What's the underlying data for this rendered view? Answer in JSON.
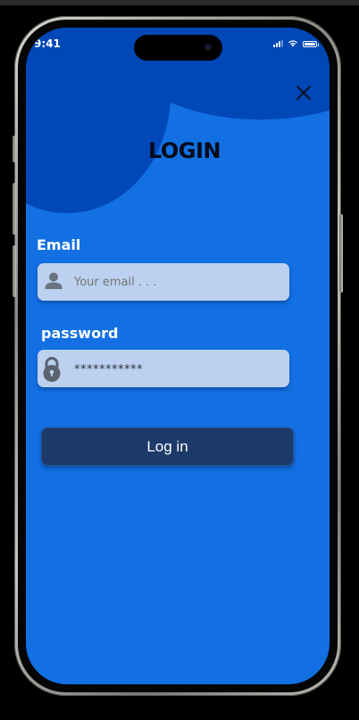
{
  "status_bar": {
    "time": "9:41"
  },
  "title": "LOGIN",
  "email": {
    "label": "Email",
    "placeholder": "Your email . . ."
  },
  "password": {
    "label": "password",
    "masked_value": "***********"
  },
  "login_button": {
    "label": "Log in"
  },
  "colors": {
    "screen_background": "#1270e3",
    "decor_blob": "#0047b8",
    "input_background": "#bcd1ef",
    "button_background": "#1c3a6a"
  },
  "icons": {
    "close": "close-icon",
    "email_field": "user-icon",
    "password_field": "lock-icon"
  }
}
